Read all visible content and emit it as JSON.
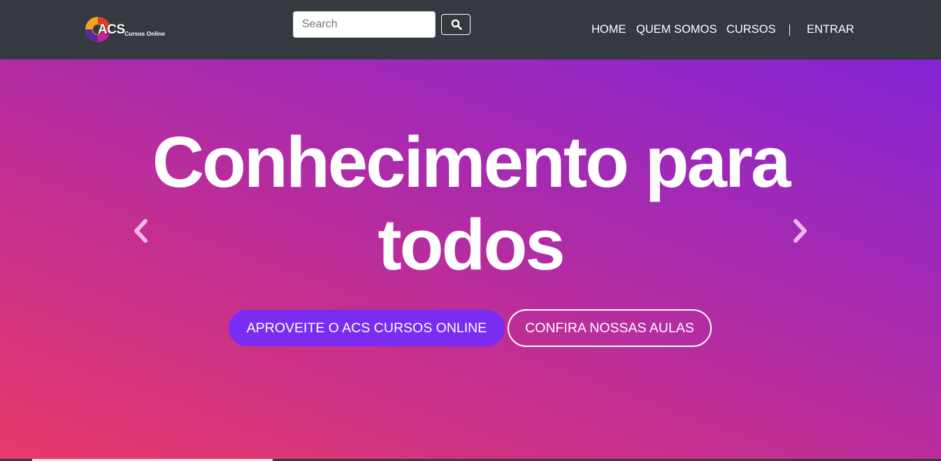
{
  "brand": {
    "logo_text": "ACS",
    "logo_subtext": "Cursos Online"
  },
  "search": {
    "placeholder": "Search",
    "value": ""
  },
  "nav": {
    "items": [
      {
        "label": "HOME"
      },
      {
        "label": "QUEM SOMOS"
      },
      {
        "label": "CURSOS"
      },
      {
        "label": "ENTRAR"
      }
    ]
  },
  "hero": {
    "title": "Conhecimento para todos",
    "primary_button": "APROVEITE O ACS CURSOS ONLINE",
    "secondary_button": "CONFIRA NOSSAS AULAS"
  },
  "colors": {
    "navbar_bg": "#343a40",
    "hero_gradient_start": "#e83a6a",
    "hero_gradient_end": "#8424d4",
    "primary_button": "#7a2cf0"
  },
  "icons": {
    "search_button": "search-icon",
    "carousel_prev": "chevron-left-icon",
    "carousel_next": "chevron-right-icon"
  }
}
